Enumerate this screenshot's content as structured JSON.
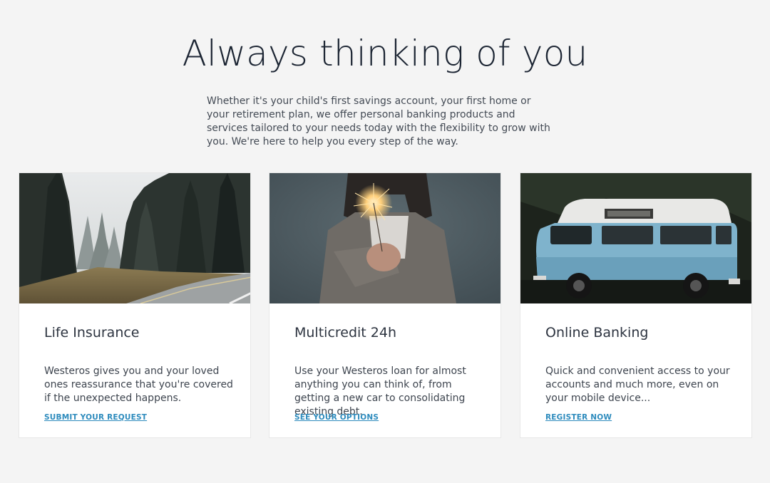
{
  "header": {
    "title": "Always thinking of you",
    "intro": "Whether it's your child's first savings account, your first home or your retirement plan, we offer personal banking products and services tailored to your needs today with the flexibility to grow with you. We're here to help you every step of the way."
  },
  "cards": [
    {
      "title": "Life Insurance",
      "text": "Westeros gives you and your loved ones reassurance that you're covered if the unexpected happens.",
      "link": "SUBMIT YOUR REQUEST",
      "image": "forest-road-photo"
    },
    {
      "title": "Multicredit 24h",
      "text": "Use your Westeros loan for almost anything you can think of, from getting a new car to consolidating existing debt.",
      "link": "SEE YOUR OPTIONS",
      "image": "sparkler-photo"
    },
    {
      "title": "Online Banking",
      "text": "Quick and convenient access to your accounts and much more, even on your mobile device...",
      "link": "REGISTER NOW",
      "image": "blue-van-photo"
    }
  ],
  "colors": {
    "background": "#f4f4f4",
    "title": "#1c2533",
    "link": "#2d8bbd",
    "card": "#ffffff"
  }
}
